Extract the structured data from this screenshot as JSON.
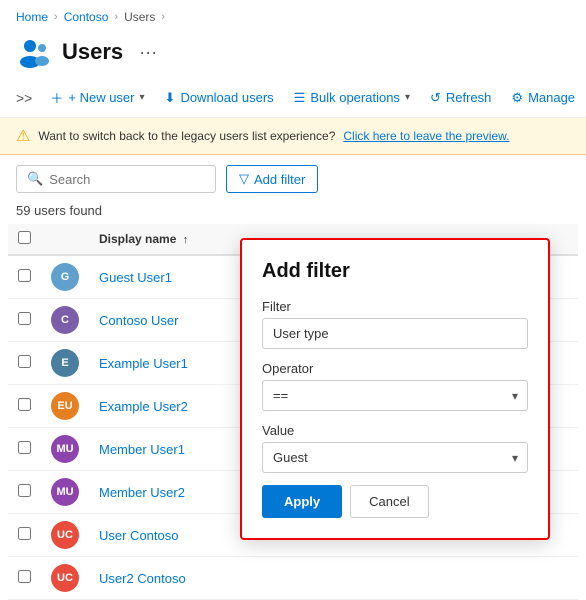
{
  "breadcrumb": {
    "items": [
      "Home",
      "Contoso",
      "Users"
    ]
  },
  "page": {
    "title": "Users",
    "icon_label": "users-icon"
  },
  "toolbar": {
    "expand_label": ">>",
    "new_user_label": "+ New user",
    "download_label": "Download users",
    "bulk_label": "Bulk operations",
    "refresh_label": "Refresh",
    "manage_label": "Manage"
  },
  "banner": {
    "text": "Want to switch back to the legacy users list experience?",
    "link_text": "Click here to leave the preview."
  },
  "filter": {
    "search_placeholder": "Search",
    "add_filter_label": "Add filter"
  },
  "users_count": "59 users found",
  "table": {
    "col_display_name": "Display name",
    "users": [
      {
        "initials": "G",
        "name": "Guest User1",
        "color": "photo",
        "img_color": "#60a0cc"
      },
      {
        "initials": "C",
        "name": "Contoso User",
        "color": "photo",
        "img_color": "#7b5ea7"
      },
      {
        "initials": "E",
        "name": "Example User1",
        "color": "photo",
        "img_color": "#4a7ea0"
      },
      {
        "initials": "EU",
        "name": "Example User2",
        "color": "eu"
      },
      {
        "initials": "MU",
        "name": "Member User1",
        "color": "mu"
      },
      {
        "initials": "MU",
        "name": "Member User2",
        "color": "mu"
      },
      {
        "initials": "UC",
        "name": "User Contoso",
        "color": "uc"
      },
      {
        "initials": "UC",
        "name": "User2 Contoso",
        "color": "uc2"
      }
    ]
  },
  "add_filter_panel": {
    "title": "Add filter",
    "filter_label": "Filter",
    "filter_value": "User type",
    "operator_label": "Operator",
    "operator_value": "==",
    "value_label": "Value",
    "value_value": "Guest",
    "apply_label": "Apply",
    "cancel_label": "Cancel"
  }
}
